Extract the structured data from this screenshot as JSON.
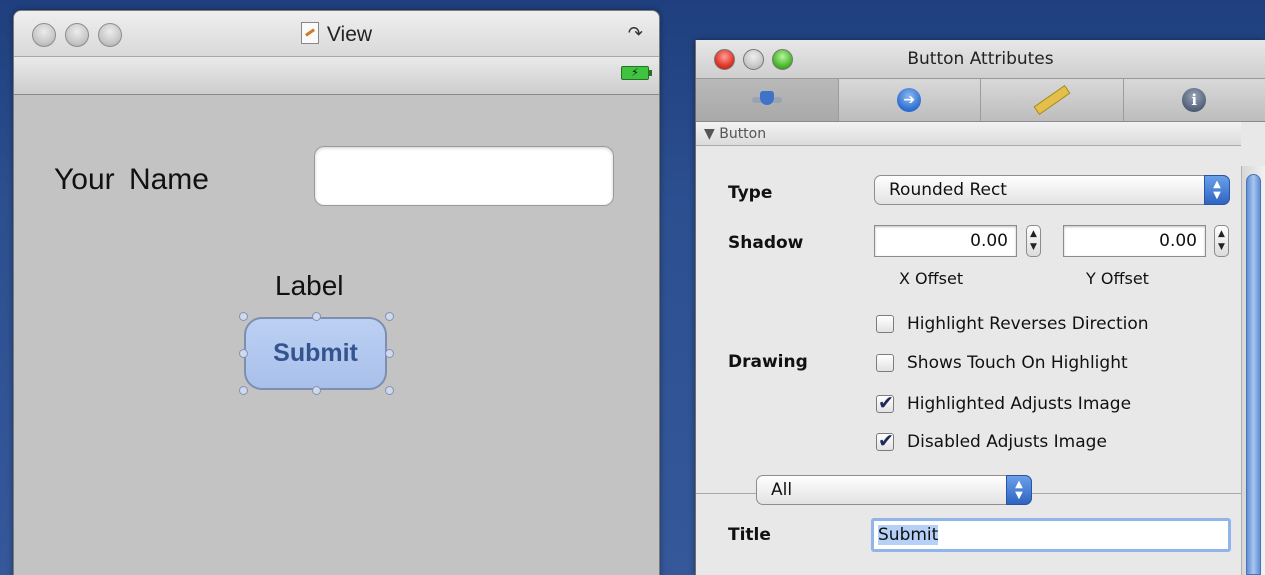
{
  "view_window": {
    "title": "View",
    "name_label": "Your  Name",
    "name_value": "",
    "label_text": "Label",
    "submit_label": "Submit",
    "battery_glyph": "⚡"
  },
  "attributes_window": {
    "title": "Button Attributes",
    "tabs": [
      {
        "icon": "slider-icon"
      },
      {
        "icon": "connections-arrow-icon",
        "glyph": "➔"
      },
      {
        "icon": "ruler-icon"
      },
      {
        "icon": "info-icon",
        "glyph": "i"
      }
    ],
    "section": "▼ Button",
    "type": {
      "label": "Type",
      "value": "Rounded Rect"
    },
    "shadow": {
      "label": "Shadow",
      "x_value": "0.00",
      "y_value": "0.00",
      "x_caption": "X Offset",
      "y_caption": "Y Offset"
    },
    "drawing": {
      "label": "Drawing",
      "options": [
        {
          "label": "Highlight Reverses Direction",
          "checked": false
        },
        {
          "label": "Shows Touch On Highlight",
          "checked": false
        },
        {
          "label": "Highlighted Adjusts Image",
          "checked": true
        },
        {
          "label": "Disabled Adjusts Image",
          "checked": true
        }
      ]
    },
    "state_popup": "All",
    "title_field": {
      "label": "Title",
      "value": "Submit"
    }
  }
}
